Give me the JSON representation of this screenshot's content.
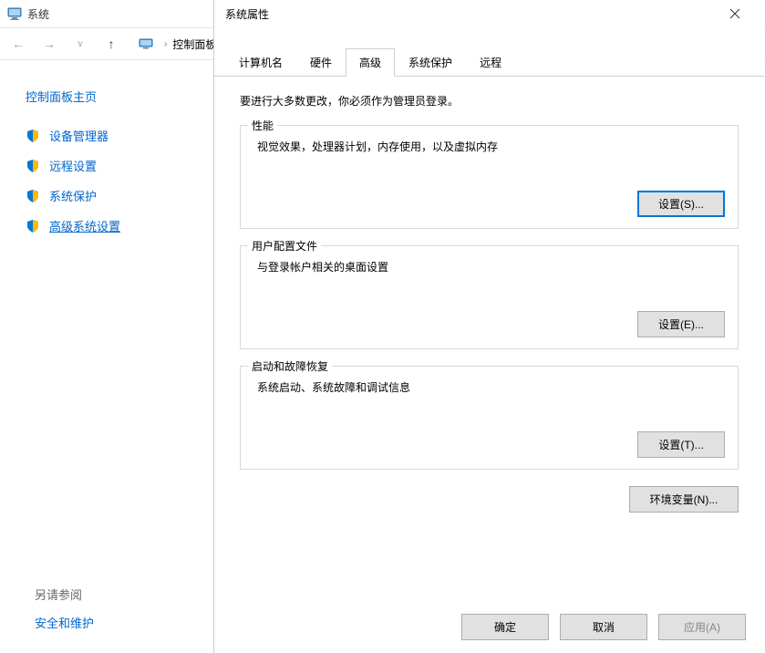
{
  "bg_window": {
    "title": "系统",
    "icon_name": "computer-icon",
    "nav": {
      "breadcrumb_item": "控制面板"
    },
    "side": {
      "home": "控制面板主页",
      "items": [
        {
          "label": "设备管理器",
          "active": false
        },
        {
          "label": "远程设置",
          "active": false
        },
        {
          "label": "系统保护",
          "active": false
        },
        {
          "label": "高级系统设置",
          "active": true
        }
      ],
      "see_also": {
        "header": "另请参阅",
        "link": "安全和维护"
      }
    }
  },
  "dialog": {
    "title": "系统属性",
    "tabs": [
      {
        "label": "计算机名",
        "active": false
      },
      {
        "label": "硬件",
        "active": false
      },
      {
        "label": "高级",
        "active": true
      },
      {
        "label": "系统保护",
        "active": false
      },
      {
        "label": "远程",
        "active": false
      }
    ],
    "admin_note": "要进行大多数更改，你必须作为管理员登录。",
    "groups": [
      {
        "legend": "性能",
        "desc": "视觉效果，处理器计划，内存使用，以及虚拟内存",
        "button": "设置(S)...",
        "highlight": true
      },
      {
        "legend": "用户配置文件",
        "desc": "与登录帐户相关的桌面设置",
        "button": "设置(E)...",
        "highlight": false
      },
      {
        "legend": "启动和故障恢复",
        "desc": "系统启动、系统故障和调试信息",
        "button": "设置(T)...",
        "highlight": false
      }
    ],
    "env_button": "环境变量(N)...",
    "buttons": {
      "ok": "确定",
      "cancel": "取消",
      "apply": "应用(A)"
    }
  }
}
